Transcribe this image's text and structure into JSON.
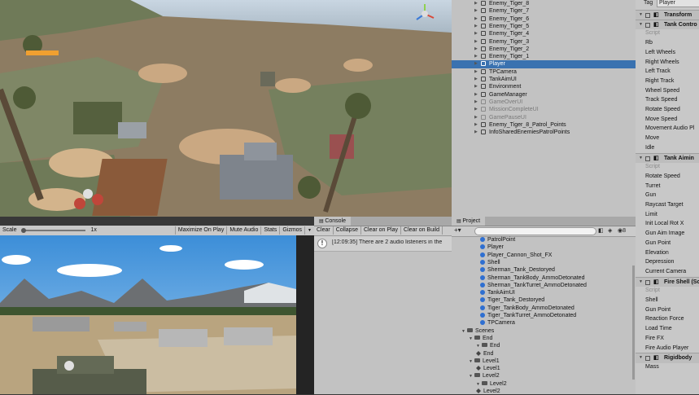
{
  "hierarchy": {
    "items": [
      {
        "label": "Enemy_Tiger_8",
        "state": "normal"
      },
      {
        "label": "Enemy_Tiger_7",
        "state": "normal"
      },
      {
        "label": "Enemy_Tiger_6",
        "state": "normal"
      },
      {
        "label": "Enemy_Tiger_5",
        "state": "normal"
      },
      {
        "label": "Enemy_Tiger_4",
        "state": "normal"
      },
      {
        "label": "Enemy_Tiger_3",
        "state": "normal"
      },
      {
        "label": "Enemy_Tiger_2",
        "state": "normal"
      },
      {
        "label": "Enemy_Tiger_1",
        "state": "normal"
      },
      {
        "label": "Player",
        "state": "selected"
      },
      {
        "label": "TPCamera",
        "state": "normal"
      },
      {
        "label": "TankAimUI",
        "state": "normal"
      },
      {
        "label": "Environment",
        "state": "normal"
      },
      {
        "label": "GameManager",
        "state": "normal"
      },
      {
        "label": "GameOverUI",
        "state": "inactive"
      },
      {
        "label": "MissionCompleteUI",
        "state": "inactive"
      },
      {
        "label": "GamePauseUI",
        "state": "inactive"
      },
      {
        "label": "Enemy_Tiger_8_Patrol_Points",
        "state": "normal"
      },
      {
        "label": "InfoSharedEnemiesPatrolPoints",
        "state": "normal"
      }
    ]
  },
  "game_toolbar": {
    "scale_label": "Scale",
    "scale_value": "1x",
    "buttons": [
      "Maximize On Play",
      "Mute Audio",
      "Stats",
      "Gizmos"
    ]
  },
  "console": {
    "tab": "Console",
    "buttons": [
      "Clear",
      "Collapse",
      "Clear on Play",
      "Clear on Build"
    ],
    "message": "[12:09:35] There are 2 audio listeners in the"
  },
  "project": {
    "tab": "Project",
    "search_placeholder": "",
    "count": "8",
    "prefabs": [
      "PatrolPoint",
      "Player",
      "Player_Cannon_Shot_FX",
      "Shell",
      "Sherman_Tank_Destoryed",
      "Sherman_TankBody_AmmoDetonated",
      "Sherman_TankTurret_AmmoDetonated",
      "TankAimUI",
      "Tiger_Tank_Destoryed",
      "Tiger_TankBody_AmmoDetonated",
      "Tiger_TankTurret_AmmoDetonated",
      "TPCamera"
    ],
    "folders": [
      {
        "label": "Scenes",
        "indent": 0,
        "kind": "folder"
      },
      {
        "label": "End",
        "indent": 1,
        "kind": "folder"
      },
      {
        "label": "End",
        "indent": 2,
        "kind": "folder"
      },
      {
        "label": "End",
        "indent": 2,
        "kind": "scene"
      },
      {
        "label": "Level1",
        "indent": 1,
        "kind": "folder"
      },
      {
        "label": "Level1",
        "indent": 2,
        "kind": "scene"
      },
      {
        "label": "Level2",
        "indent": 1,
        "kind": "folder"
      },
      {
        "label": "Level2",
        "indent": 2,
        "kind": "folder"
      },
      {
        "label": "Level2",
        "indent": 2,
        "kind": "scene"
      }
    ]
  },
  "inspector": {
    "tag_label": "Tag",
    "tag_value": "Player",
    "rows": [
      {
        "label": "Transform",
        "kind": "header"
      },
      {
        "label": "Tank Contro",
        "kind": "header"
      },
      {
        "label": "Script",
        "kind": "dim"
      },
      {
        "label": "Rb",
        "kind": "field"
      },
      {
        "label": "Left Wheels",
        "kind": "field"
      },
      {
        "label": "Right Wheels",
        "kind": "field"
      },
      {
        "label": "Left Track",
        "kind": "field"
      },
      {
        "label": "Right Track",
        "kind": "field"
      },
      {
        "label": "Wheel Speed",
        "kind": "field"
      },
      {
        "label": "Track Speed",
        "kind": "field"
      },
      {
        "label": "Rotate Speed",
        "kind": "field"
      },
      {
        "label": "Move Speed",
        "kind": "field"
      },
      {
        "label": "Movement Audio Pl",
        "kind": "field"
      },
      {
        "label": "Move",
        "kind": "field"
      },
      {
        "label": "Idle",
        "kind": "field"
      },
      {
        "label": "Tank Aimin",
        "kind": "header"
      },
      {
        "label": "Script",
        "kind": "dim"
      },
      {
        "label": "Rotate Speed",
        "kind": "field"
      },
      {
        "label": "Turret",
        "kind": "field"
      },
      {
        "label": "Gun",
        "kind": "field"
      },
      {
        "label": "Raycast Target",
        "kind": "field"
      },
      {
        "label": "Limit",
        "kind": "field"
      },
      {
        "label": "Init Local Rot X",
        "kind": "field"
      },
      {
        "label": "Gun Aim Image",
        "kind": "field"
      },
      {
        "label": "Gun Point",
        "kind": "field"
      },
      {
        "label": "Elevation",
        "kind": "field"
      },
      {
        "label": "Depression",
        "kind": "field"
      },
      {
        "label": "Current Camera",
        "kind": "field"
      },
      {
        "label": "Fire Shell (Sc",
        "kind": "header"
      },
      {
        "label": "Script",
        "kind": "dim"
      },
      {
        "label": "Shell",
        "kind": "field"
      },
      {
        "label": "Gun Point",
        "kind": "field"
      },
      {
        "label": "Reaction Force",
        "kind": "field"
      },
      {
        "label": "Load Time",
        "kind": "field"
      },
      {
        "label": "Fire FX",
        "kind": "field"
      },
      {
        "label": "Fire Audio Player",
        "kind": "field"
      },
      {
        "label": "Rigidbody",
        "kind": "header"
      },
      {
        "label": "Mass",
        "kind": "field"
      }
    ]
  }
}
